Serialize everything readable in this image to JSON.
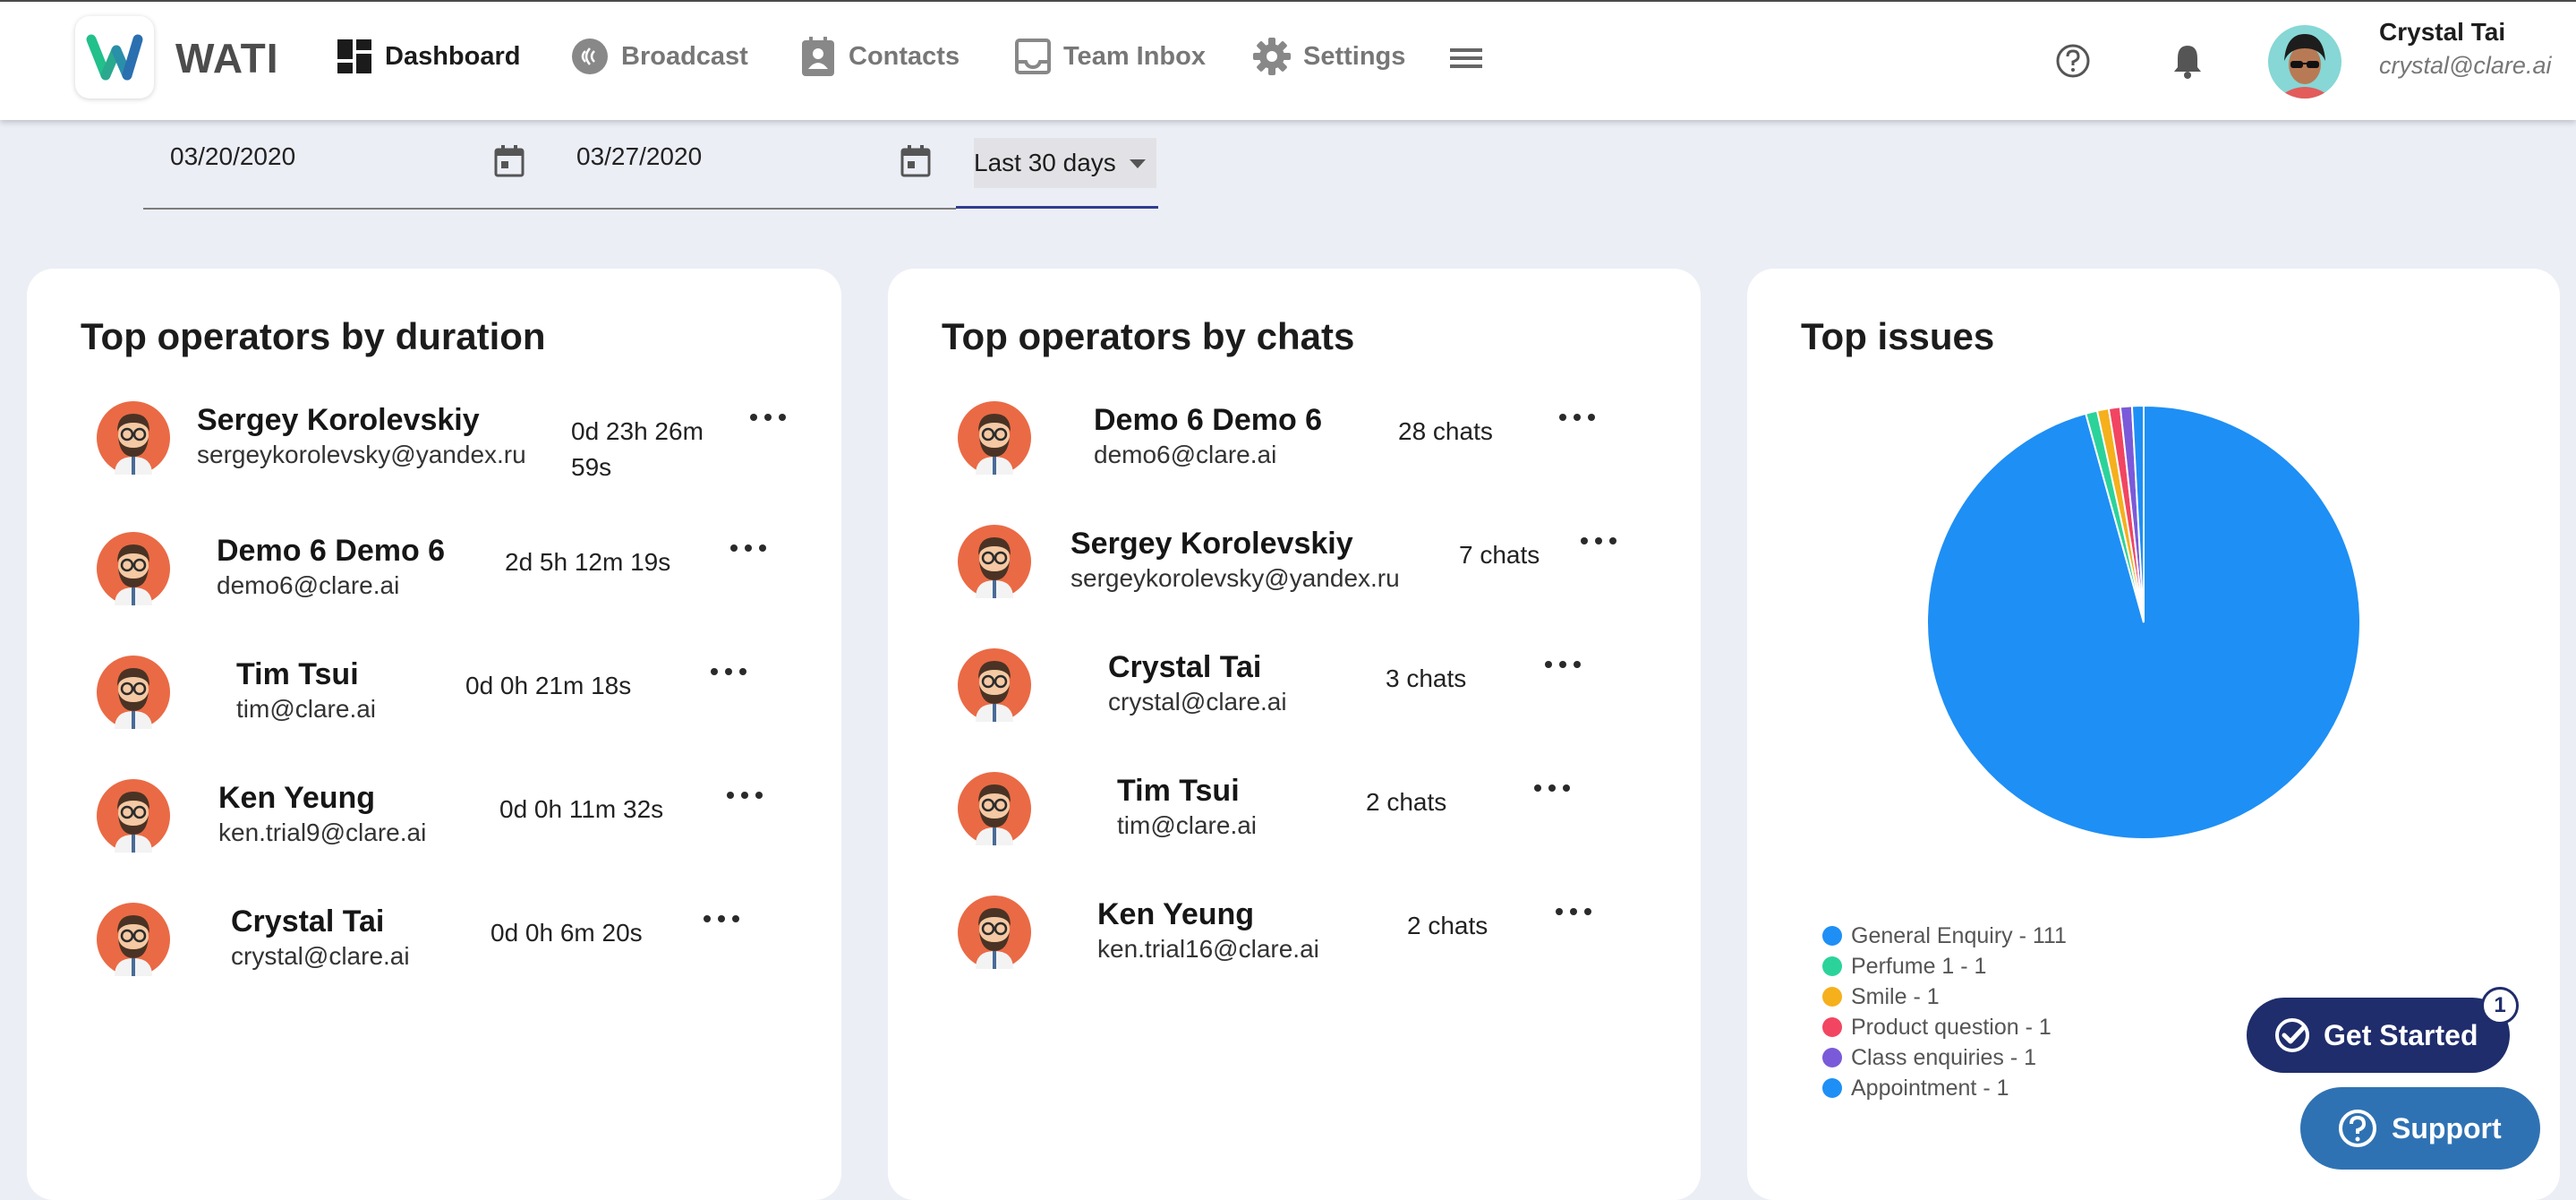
{
  "app": {
    "name": "WATI"
  },
  "nav": {
    "items": [
      {
        "label": "Dashboard",
        "icon": "dashboard-icon",
        "active": true
      },
      {
        "label": "Broadcast",
        "icon": "broadcast-icon",
        "active": false
      },
      {
        "label": "Contacts",
        "icon": "contacts-icon",
        "active": false
      },
      {
        "label": "Team Inbox",
        "icon": "inbox-icon",
        "active": false
      },
      {
        "label": "Settings",
        "icon": "gear-icon",
        "active": false
      }
    ],
    "menu_icon": "hamburger-icon",
    "help_icon": "help-circle-icon",
    "notification_icon": "bell-icon"
  },
  "user": {
    "name": "Crystal Tai",
    "email": "crystal@clare.ai"
  },
  "filters": {
    "start_date": "03/20/2020",
    "end_date": "03/27/2020",
    "range": "Last 30 days"
  },
  "cards": {
    "duration": {
      "title": "Top operators by duration",
      "rows": [
        {
          "name": "Sergey Korolevskiy",
          "email": "sergeykorolevsky@yandex.ru",
          "metric_line1": "0d 23h 26m",
          "metric_line2": "59s"
        },
        {
          "name": "Demo 6 Demo 6",
          "email": "demo6@clare.ai",
          "metric_line1": "2d 5h 12m 19s",
          "metric_line2": ""
        },
        {
          "name": "Tim Tsui",
          "email": "tim@clare.ai",
          "metric_line1": "0d 0h 21m 18s",
          "metric_line2": ""
        },
        {
          "name": "Ken Yeung",
          "email": "ken.trial9@clare.ai",
          "metric_line1": "0d 0h 11m 32s",
          "metric_line2": ""
        },
        {
          "name": "Crystal Tai",
          "email": "crystal@clare.ai",
          "metric_line1": "0d 0h 6m 20s",
          "metric_line2": ""
        }
      ]
    },
    "chats": {
      "title": "Top operators by chats",
      "rows": [
        {
          "name": "Demo 6 Demo 6",
          "email": "demo6@clare.ai",
          "metric": "28 chats"
        },
        {
          "name": "Sergey Korolevskiy",
          "email": "sergeykorolevsky@yandex.ru",
          "metric": "7 chats"
        },
        {
          "name": "Crystal Tai",
          "email": "crystal@clare.ai",
          "metric": "3 chats"
        },
        {
          "name": "Tim Tsui",
          "email": "tim@clare.ai",
          "metric": "2 chats"
        },
        {
          "name": "Ken Yeung",
          "email": "ken.trial16@clare.ai",
          "metric": "2 chats"
        }
      ]
    },
    "issues": {
      "title": "Top issues",
      "legend": [
        {
          "label": "General Enquiry - 111",
          "color": "#1e8ff5"
        },
        {
          "label": "Perfume 1 - 1",
          "color": "#2bd39a"
        },
        {
          "label": "Smile - 1",
          "color": "#f5b01c"
        },
        {
          "label": "Product question - 1",
          "color": "#f24561"
        },
        {
          "label": "Class enquiries - 1",
          "color": "#7a5ad9"
        },
        {
          "label": "Appointment - 1",
          "color": "#1e8ff5"
        }
      ]
    }
  },
  "chart_data": {
    "type": "pie",
    "categories": [
      "General Enquiry",
      "Perfume 1",
      "Smile",
      "Product question",
      "Class enquiries",
      "Appointment"
    ],
    "values": [
      111,
      1,
      1,
      1,
      1,
      1
    ],
    "colors": [
      "#1e8ff5",
      "#2bd39a",
      "#f5b01c",
      "#f24561",
      "#7a5ad9",
      "#1e8ff5"
    ],
    "title": "Top issues",
    "legend": "bottom-left"
  },
  "floating": {
    "get_started": "Get Started",
    "get_started_badge": "1",
    "support": "Support"
  },
  "colors": {
    "accent": "#1f2d6c",
    "support": "#2f72b3",
    "page_bg": "#eceef6",
    "avatar_bg": "#ea6a45"
  }
}
